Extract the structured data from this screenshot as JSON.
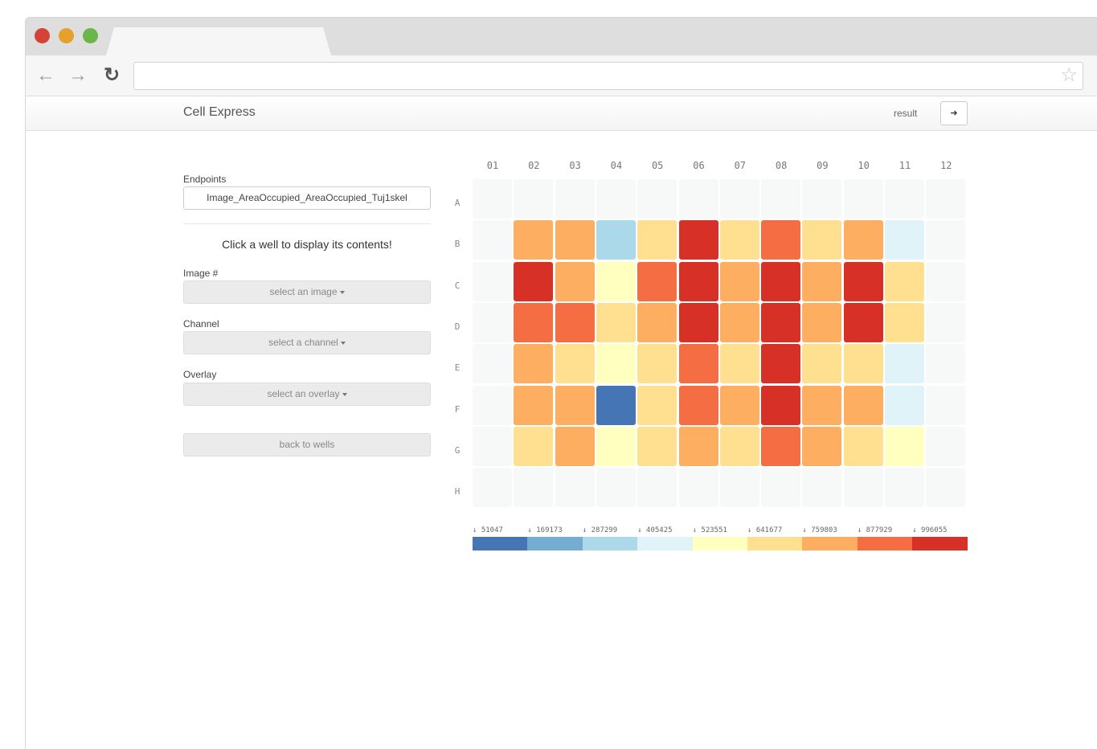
{
  "browser": {
    "traffic_colors": [
      "#d64238",
      "#e6a12b",
      "#6ab648"
    ],
    "back_icon": "arrow-left",
    "forward_icon": "arrow-right",
    "reload_icon": "reload",
    "bookmark_icon": "star-outline"
  },
  "app": {
    "brand": "Cell Express",
    "result_label": "result",
    "logout_icon": "sign-out"
  },
  "sidebar": {
    "endpoints_label": "Endpoints",
    "endpoint_value": "Image_AreaOccupied_AreaOccupied_Tuj1skel",
    "click_prompt": "Click a well to display its contents!",
    "image_label": "Image #",
    "image_select": "select an image",
    "channel_label": "Channel",
    "channel_select": "select a channel",
    "overlay_label": "Overlay",
    "overlay_select": "select an overlay",
    "back_button": "back to wells"
  },
  "plate": {
    "columns": [
      "01",
      "02",
      "03",
      "04",
      "05",
      "06",
      "07",
      "08",
      "09",
      "10",
      "11",
      "12"
    ],
    "rows": [
      "A",
      "B",
      "C",
      "D",
      "E",
      "F",
      "G",
      "H"
    ],
    "empty_color": "#f7f8f8",
    "palette": [
      "#4575b4",
      "#74add1",
      "#abd9e9",
      "#e0f3f8",
      "#ffffbf",
      "#fee090",
      "#fdae61",
      "#f46d43",
      "#d73027"
    ],
    "cells": [
      [
        -1,
        -1,
        -1,
        -1,
        -1,
        -1,
        -1,
        -1,
        -1,
        -1,
        -1,
        -1
      ],
      [
        -1,
        6,
        6,
        2,
        5,
        8,
        5,
        7,
        5,
        6,
        3,
        -1
      ],
      [
        -1,
        8,
        6,
        4,
        7,
        8,
        6,
        8,
        6,
        8,
        5,
        -1
      ],
      [
        -1,
        7,
        7,
        5,
        6,
        8,
        6,
        8,
        6,
        8,
        5,
        -1
      ],
      [
        -1,
        6,
        5,
        4,
        5,
        7,
        5,
        8,
        5,
        5,
        3,
        -1
      ],
      [
        -1,
        6,
        6,
        0,
        5,
        7,
        6,
        8,
        6,
        6,
        3,
        -1
      ],
      [
        -1,
        5,
        6,
        4,
        5,
        6,
        5,
        7,
        6,
        5,
        4,
        -1
      ],
      [
        -1,
        -1,
        -1,
        -1,
        -1,
        -1,
        -1,
        -1,
        -1,
        -1,
        -1,
        -1
      ]
    ]
  },
  "legend": {
    "labels": [
      "↓ 51047",
      "↓ 169173",
      "↓ 287299",
      "↓ 405425",
      "↓ 523551",
      "↓ 641677",
      "↓ 759803",
      "↓ 877929",
      "↓ 996055"
    ]
  }
}
